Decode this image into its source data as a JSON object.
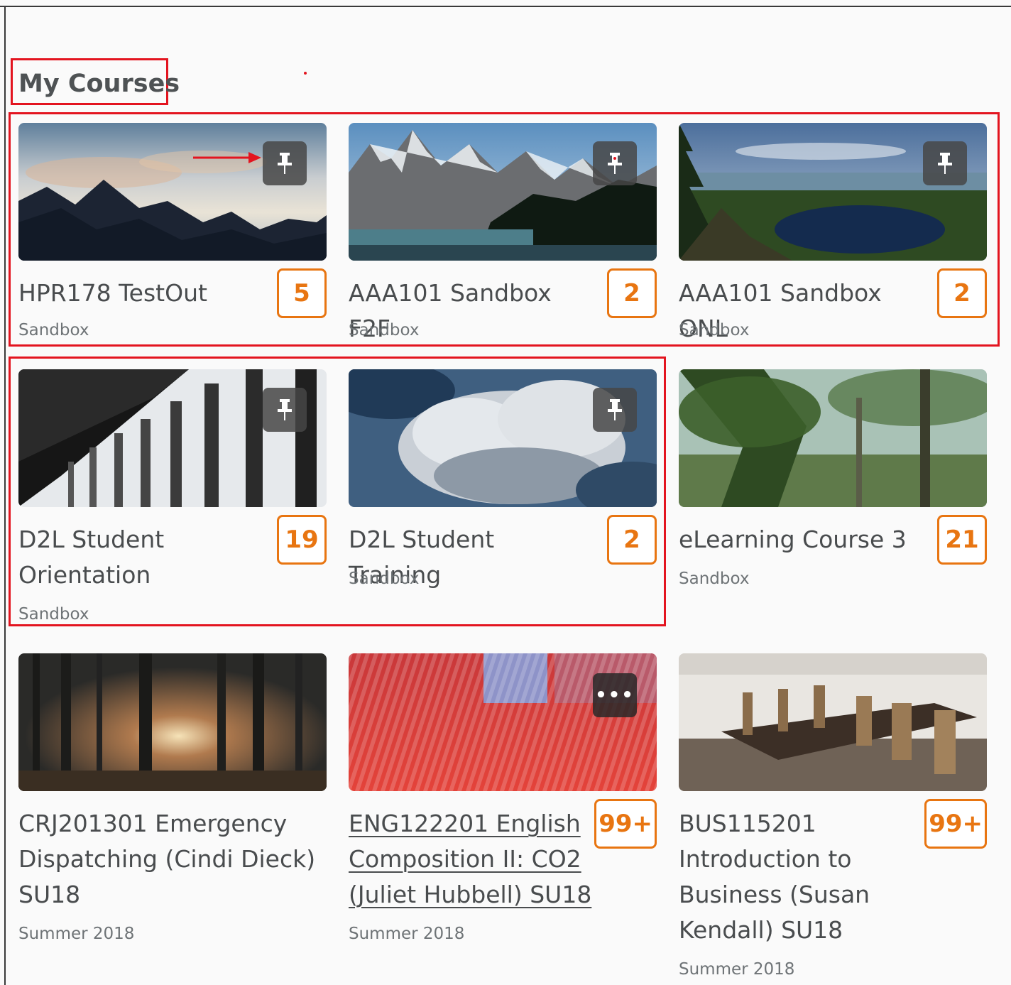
{
  "page": {
    "title": "My Courses"
  },
  "courses": [
    {
      "name": "HPR178 TestOut",
      "subtitle": "Sandbox",
      "badge": "5",
      "button_icon": "pin-icon"
    },
    {
      "name": "AAA101 Sandbox F2F",
      "subtitle": "Sandbox",
      "badge": "2",
      "button_icon": "pin-icon"
    },
    {
      "name": "AAA101 Sandbox ONL",
      "subtitle": "Sandbox",
      "badge": "2",
      "button_icon": "pin-icon"
    },
    {
      "name": "D2L Student Orientation",
      "subtitle": "Sandbox",
      "badge": "19",
      "button_icon": "pin-icon"
    },
    {
      "name": "D2L Student Training",
      "subtitle": "Sandbox",
      "badge": "2",
      "button_icon": "pin-icon"
    },
    {
      "name": "eLearning Course 3",
      "subtitle": "Sandbox",
      "badge": "21"
    },
    {
      "name": "CRJ201301 Emergency Dispatching (Cindi Dieck) SU18",
      "subtitle": "Summer 2018"
    },
    {
      "name": "ENG122201 English Composition II: CO2 (Juliet Hubbell) SU18",
      "subtitle": "Summer 2018",
      "badge": "99+",
      "button_icon": "more-options-icon",
      "button_label": "•••"
    },
    {
      "name": "BUS115201 Introduction to Business (Susan Kendall) SU18",
      "subtitle": "Summer 2018",
      "badge": "99+"
    }
  ],
  "colors": {
    "highlight": "#e3141f",
    "badge": "#e87511",
    "text": "#494c4e"
  }
}
